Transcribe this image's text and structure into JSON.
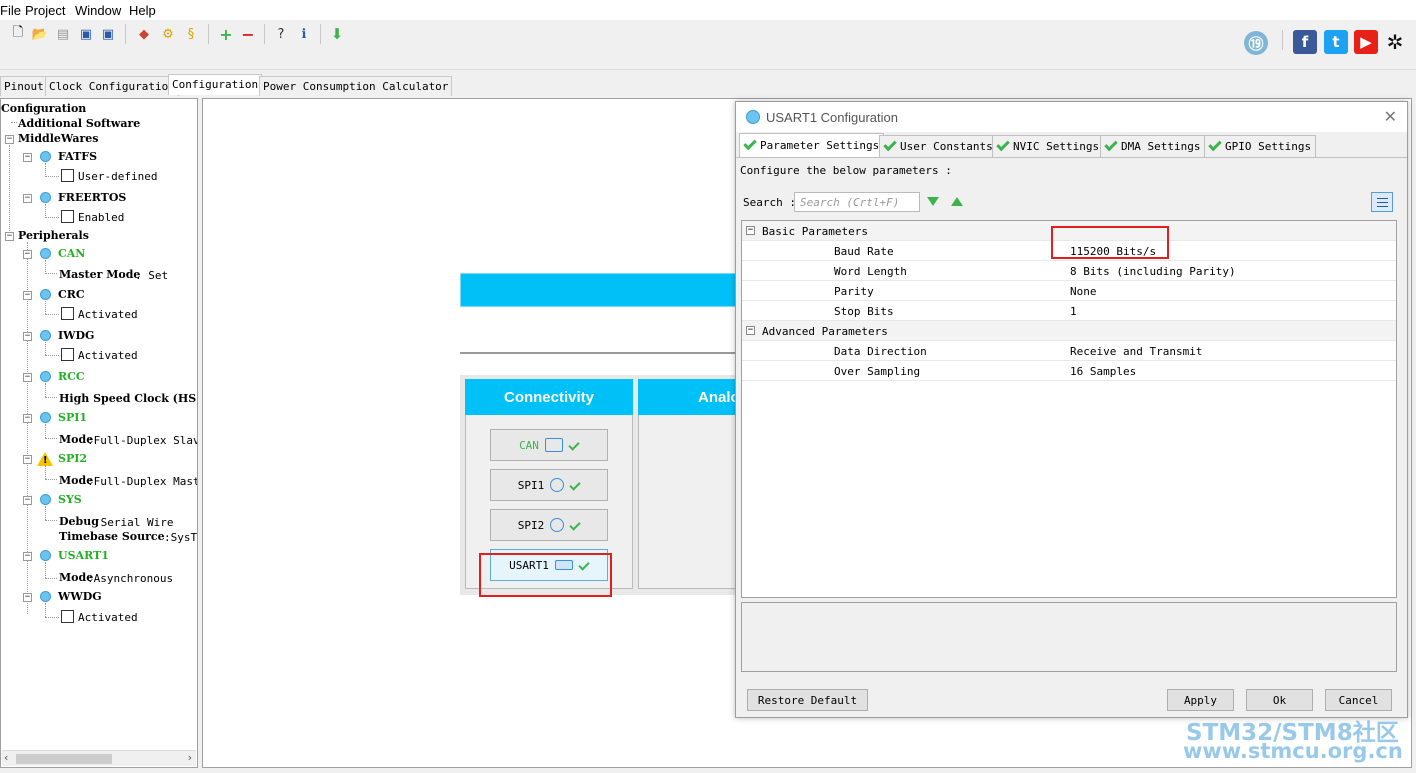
{
  "menu": [
    "File",
    "Project",
    "Window",
    "Help"
  ],
  "tabs": [
    "Pinout",
    "Clock Configuration",
    "Configuration",
    "Power Consumption Calculator"
  ],
  "tree": {
    "root": "Configuration",
    "additional": "Additional Software",
    "middlewares": "MiddleWares",
    "fatfs": "FATFS",
    "fatfs_opt": "User-defined",
    "freertos": "FREERTOS",
    "freertos_opt": "Enabled",
    "peripherals": "Peripherals",
    "can": "CAN",
    "can_mode_key": "Master Mode",
    "can_mode_val": ": Set",
    "crc": "CRC",
    "crc_opt": "Activated",
    "iwdg": "IWDG",
    "iwdg_opt": "Activated",
    "rcc": "RCC",
    "rcc_line": "High Speed Clock (HS",
    "spi1": "SPI1",
    "spi1_key": "Mode",
    "spi1_val": ":Full-Duplex Slave",
    "spi2": "SPI2",
    "spi2_key": "Mode",
    "spi2_val": ":Full-Duplex Maste",
    "sys": "SYS",
    "sys_key1": "Debug",
    "sys_val1": ":Serial Wire",
    "sys_key2": "Timebase Source",
    "sys_val2": ":SysT:",
    "usart1": "USART1",
    "usart1_key": "Mode",
    "usart1_val": ":Asynchronous",
    "wwdg": "WWDG",
    "wwdg_opt": "Activated"
  },
  "main": {
    "connectivity": "Connectivity",
    "analog": "Analo",
    "buttons": [
      "CAN",
      "SPI1",
      "SPI2",
      "USART1"
    ]
  },
  "dialog": {
    "title": "USART1 Configuration",
    "tabs": [
      "Parameter Settings",
      "User Constants",
      "NVIC Settings",
      "DMA Settings",
      "GPIO Settings"
    ],
    "hint": "Configure the below parameters :",
    "search_label": "Search :",
    "search_placeholder": "Search (Crtl+F)",
    "groups": {
      "basic": "Basic Parameters",
      "advanced": "Advanced Parameters"
    },
    "params": [
      {
        "name": "Baud Rate",
        "value": "115200 Bits/s"
      },
      {
        "name": "Word Length",
        "value": "8 Bits (including Parity)"
      },
      {
        "name": "Parity",
        "value": "None"
      },
      {
        "name": "Stop Bits",
        "value": "1"
      },
      {
        "name": "Data Direction",
        "value": "Receive and Transmit"
      },
      {
        "name": "Over Sampling",
        "value": "16 Samples"
      }
    ],
    "buttons": {
      "restore": "Restore Default",
      "apply": "Apply",
      "ok": "Ok",
      "cancel": "Cancel"
    }
  },
  "watermark": {
    "line1": "STM32/STM8社区",
    "line2": "www.stmcu.org.cn"
  },
  "colors": {
    "accent_blue": "#00c0f8",
    "green_ok": "#3cb44b",
    "highlight_red": "#e02020"
  }
}
